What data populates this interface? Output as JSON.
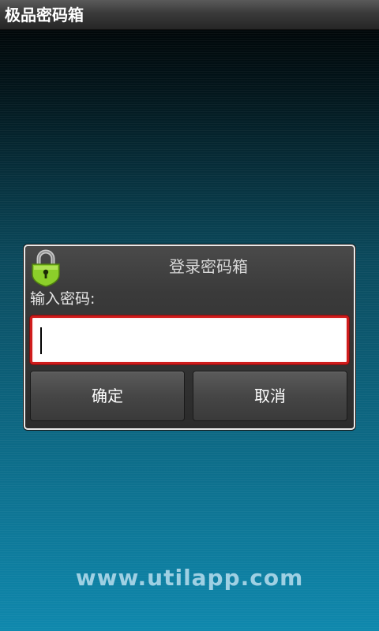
{
  "app": {
    "title": "极品密码箱"
  },
  "dialog": {
    "title": "登录密码箱",
    "icon": "padlock-icon",
    "field_label": "输入密码:",
    "password_value": "",
    "ok_label": "确定",
    "cancel_label": "取消"
  },
  "footer": {
    "url": "www.utilapp.com"
  },
  "colors": {
    "input_border": "#cf1c1c",
    "lock_green": "#8ccf2a",
    "footer_text": "#9fd0e3"
  }
}
